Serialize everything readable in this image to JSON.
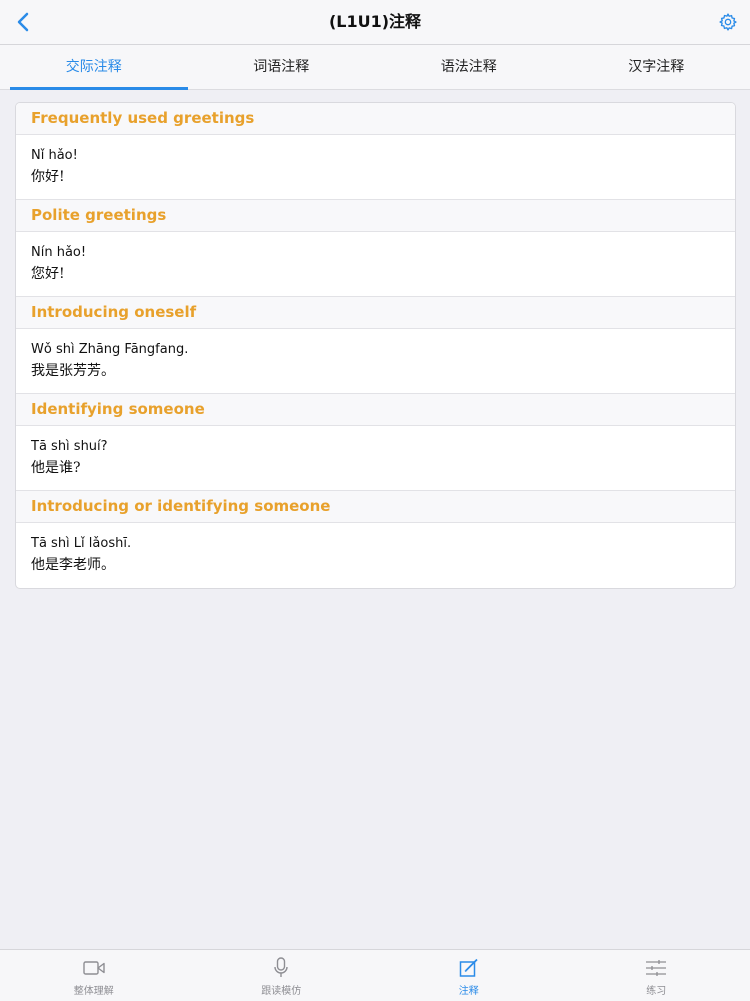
{
  "nav": {
    "title": "(L1U1)注释",
    "back_icon": "chevron-left-icon",
    "settings_icon": "gear-icon",
    "accent": "#2a8be8"
  },
  "tabs": [
    {
      "label": "交际注释",
      "active": true
    },
    {
      "label": "词语注释",
      "active": false
    },
    {
      "label": "语法注释",
      "active": false
    },
    {
      "label": "汉字注释",
      "active": false
    }
  ],
  "sections": [
    {
      "heading": "Frequently used greetings",
      "pinyin": "Nǐ hǎo!",
      "hanzi": "你好!"
    },
    {
      "heading": "Polite greetings",
      "pinyin": "Nín hǎo!",
      "hanzi": "您好!"
    },
    {
      "heading": "Introducing oneself",
      "pinyin": "Wǒ shì Zhāng Fāngfang.",
      "hanzi": "我是张芳芳。"
    },
    {
      "heading": "Identifying someone",
      "pinyin": "Tā shì shuí?",
      "hanzi": "他是谁?"
    },
    {
      "heading": "Introducing or identifying someone",
      "pinyin": "Tā shì Lǐ lǎoshī.",
      "hanzi": "他是李老师。"
    }
  ],
  "heading_color": "#e8a12c",
  "bottom_tabs": [
    {
      "label": "整体理解",
      "icon": "video-camera-icon",
      "active": false
    },
    {
      "label": "跟读模仿",
      "icon": "microphone-icon",
      "active": false
    },
    {
      "label": "注释",
      "icon": "edit-note-icon",
      "active": true
    },
    {
      "label": "练习",
      "icon": "sliders-icon",
      "active": false
    }
  ]
}
